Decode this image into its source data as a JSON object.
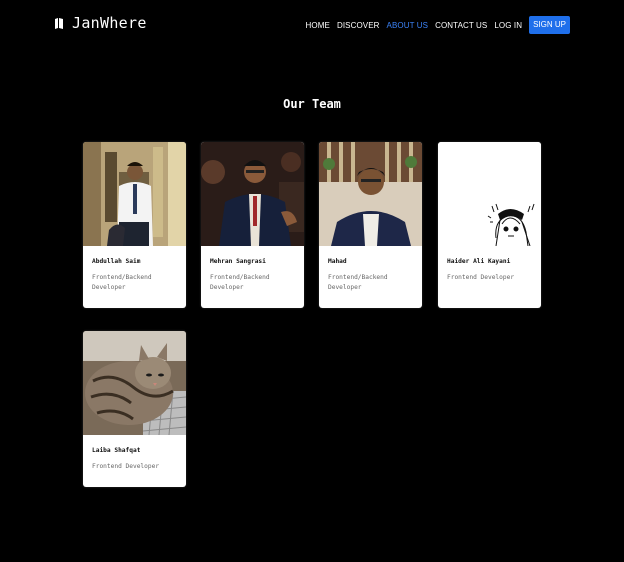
{
  "header": {
    "brand": "JanWhere",
    "brand_icon": "map-icon",
    "nav": [
      {
        "label": "HOME",
        "active": false
      },
      {
        "label": "DISCOVER",
        "active": false
      },
      {
        "label": "ABOUT US",
        "active": true
      },
      {
        "label": "CONTACT US",
        "active": false
      },
      {
        "label": "LOG IN",
        "active": false
      }
    ],
    "signup_label": "SIGN UP"
  },
  "main": {
    "title": "Our Team",
    "team": [
      {
        "name": "Abdullah Saim",
        "role": "Frontend/Backend Developer"
      },
      {
        "name": "Mehran Sangrasi",
        "role": "Frontend/Backend Developer"
      },
      {
        "name": "Mahad",
        "role": "Frontend/Backend Developer"
      },
      {
        "name": "Haider Ali Kayani",
        "role": "Frontend Developer"
      },
      {
        "name": "Laiba Shafqat",
        "role": "Frontend Developer"
      }
    ]
  },
  "colors": {
    "background": "#000000",
    "accent": "#1f6feb",
    "active_link": "#3b82f6",
    "card": "#ffffff"
  }
}
